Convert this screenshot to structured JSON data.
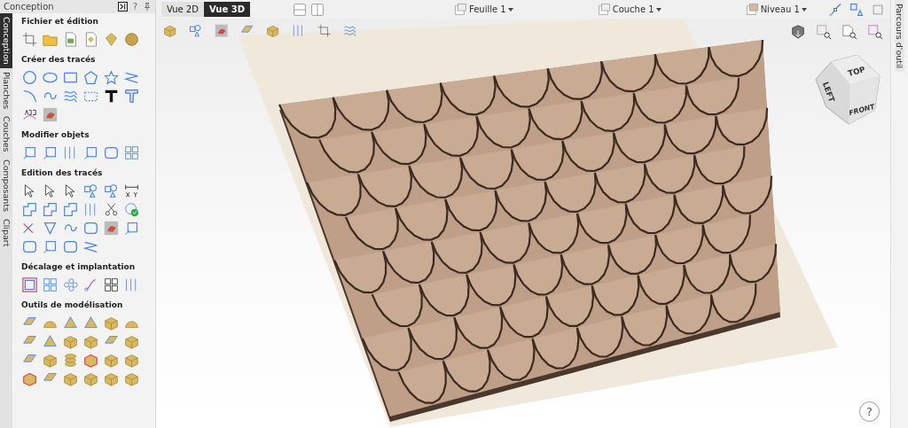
{
  "panel": {
    "title": "Conception",
    "help": "?"
  },
  "side_tabs": [
    {
      "label": "Conception",
      "selected": true
    },
    {
      "label": "Planches",
      "selected": false
    },
    {
      "label": "Couches",
      "selected": false
    },
    {
      "label": "Composants",
      "selected": false
    },
    {
      "label": "Clipart",
      "selected": false
    }
  ],
  "sections": [
    {
      "title": "Fichier et édition"
    },
    {
      "title": "Créer des tracés"
    },
    {
      "title": "Modifier objets"
    },
    {
      "title": "Edition des tracés"
    },
    {
      "title": "Décalage et implantation"
    },
    {
      "title": "Outils de modélisation"
    }
  ],
  "view_tabs": [
    {
      "label": "Vue 2D",
      "selected": false
    },
    {
      "label": "Vue 3D",
      "selected": true
    }
  ],
  "dropdowns": [
    {
      "label": "Feuille 1"
    },
    {
      "label": "Couche 1"
    },
    {
      "label": "Niveau 1"
    }
  ],
  "view_cube": {
    "top": "TOP",
    "front": "FRONT",
    "left": "LEFT"
  },
  "right_tab": {
    "label": "Parcours d'outil"
  },
  "help_button": "?"
}
